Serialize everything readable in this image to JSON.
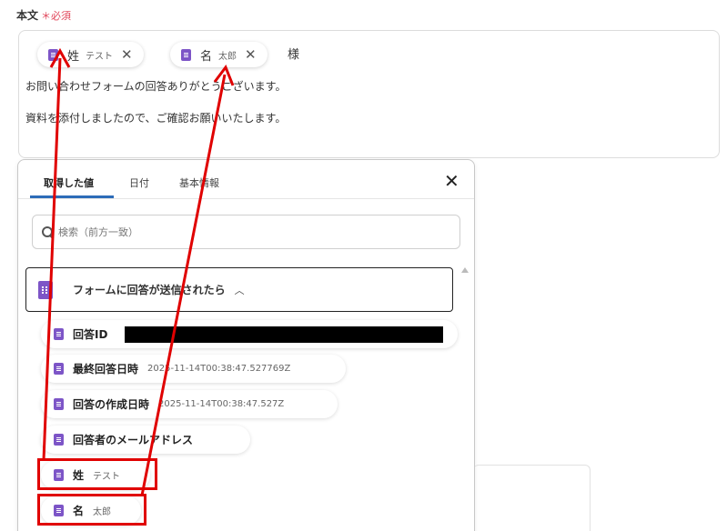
{
  "field": {
    "label": "本文",
    "required": "＊必須"
  },
  "editor": {
    "chips": [
      {
        "name": "姓",
        "value": "テスト",
        "remove": "✕"
      },
      {
        "name": "名",
        "value": "太郎",
        "remove": "✕"
      }
    ],
    "suffix": "様",
    "lines": [
      "お問い合わせフォームの回答ありがとうございます。",
      "資料を添付しましたので、ご確認お願いいたします。"
    ]
  },
  "popup": {
    "tabs": [
      "取得した値",
      "日付",
      "基本情報"
    ],
    "active_tab": "取得した値",
    "close": "✕",
    "search_placeholder": "検索（前方一致）",
    "trigger_label": "フォームに回答が送信されたら",
    "trigger_chevron": "︿",
    "items": [
      {
        "label": "回答ID",
        "value": ""
      },
      {
        "label": "最終回答日時",
        "value": "2025-11-14T00:38:47.527769Z"
      },
      {
        "label": "回答の作成日時",
        "value": "2025-11-14T00:38:47.527Z"
      },
      {
        "label": "回答者のメールアドレス",
        "value": ""
      },
      {
        "label": "姓",
        "value": "テスト"
      },
      {
        "label": "名",
        "value": "太郎"
      }
    ]
  },
  "colors": {
    "accent": "#2d6cb8",
    "icon": "#7d55c7",
    "highlight": "#e00000",
    "required": "#e0465a"
  }
}
